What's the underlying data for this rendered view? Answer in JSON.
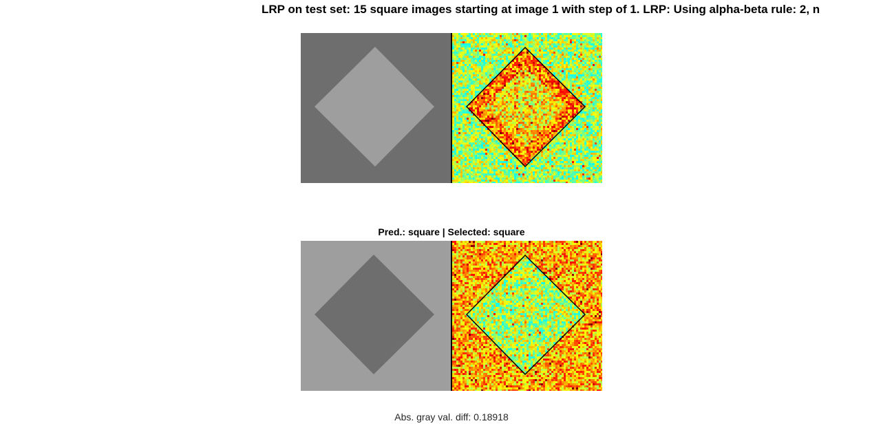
{
  "figure": {
    "title": "LRP on test set: 15 square images starting at image 1 with step of 1. LRP: Using alpha-beta rule: 2, n",
    "subplot_title": "Pred.: square | Selected: square",
    "footer": "Abs. gray val. diff: 0.18918"
  },
  "panels": [
    {
      "input_image": {
        "background_gray": "#6e6e6e",
        "square_gray": "#9e9e9e",
        "shape": "diamond"
      },
      "relevance_map": {
        "colormap": "jet",
        "emphasis": "inside",
        "outline": "diamond"
      }
    },
    {
      "input_image": {
        "background_gray": "#9e9e9e",
        "square_gray": "#6e6e6e",
        "shape": "diamond"
      },
      "relevance_map": {
        "colormap": "jet",
        "emphasis": "outside",
        "outline": "diamond"
      }
    }
  ],
  "colors": {
    "divider": "#000000",
    "outline": "#000000"
  }
}
